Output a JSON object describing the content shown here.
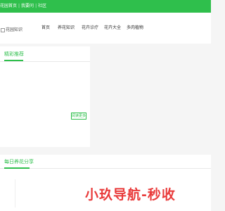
{
  "topbar": {
    "links": [
      "花园首页",
      "我要问",
      "社区"
    ]
  },
  "header": {
    "logo_alt": "花园知识"
  },
  "nav": {
    "items": [
      {
        "label": "首页"
      },
      {
        "label": "养花知识"
      },
      {
        "label": "花卉诊疗"
      },
      {
        "label": "花卉大全"
      },
      {
        "label": "多肉植物"
      }
    ]
  },
  "recommend": {
    "title": "精彩推荐",
    "more_label": "阅读更多"
  },
  "daily": {
    "title": "每日养花分享"
  },
  "watermark": {
    "text": "小玖导航-秒收"
  },
  "colors": {
    "brand_green": "#2fbf4c",
    "watermark_red": "#e93b3b"
  }
}
